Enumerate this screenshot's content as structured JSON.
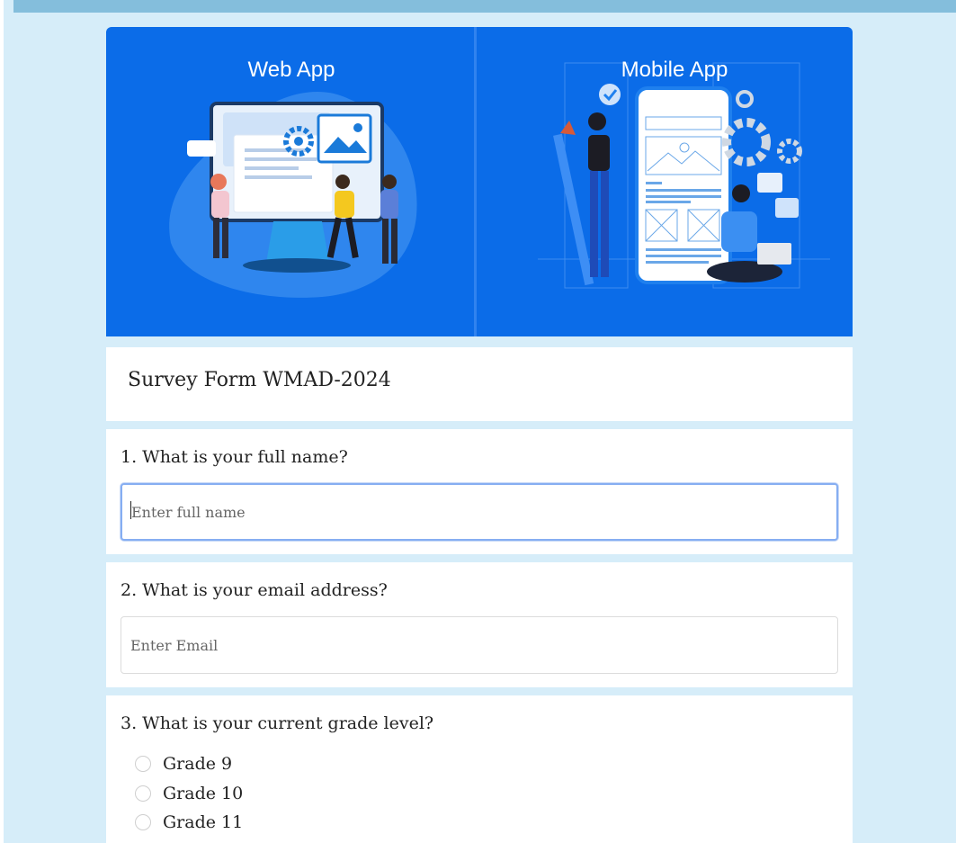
{
  "banner": {
    "left_label": "Web App",
    "right_label": "Mobile App"
  },
  "form": {
    "title": "Survey Form WMAD-2024"
  },
  "questions": [
    {
      "label": "1. What is your full name?",
      "placeholder": "Enter full name",
      "value": ""
    },
    {
      "label": "2. What is your email address?",
      "placeholder": "Enter Email",
      "value": ""
    },
    {
      "label": "3. What is your current grade level?",
      "options": [
        "Grade 9",
        "Grade 10",
        "Grade 11"
      ]
    }
  ],
  "colors": {
    "page_background": "#d6edf9",
    "banner_blue": "#0b6ce8",
    "focus_border": "#86aef2"
  }
}
